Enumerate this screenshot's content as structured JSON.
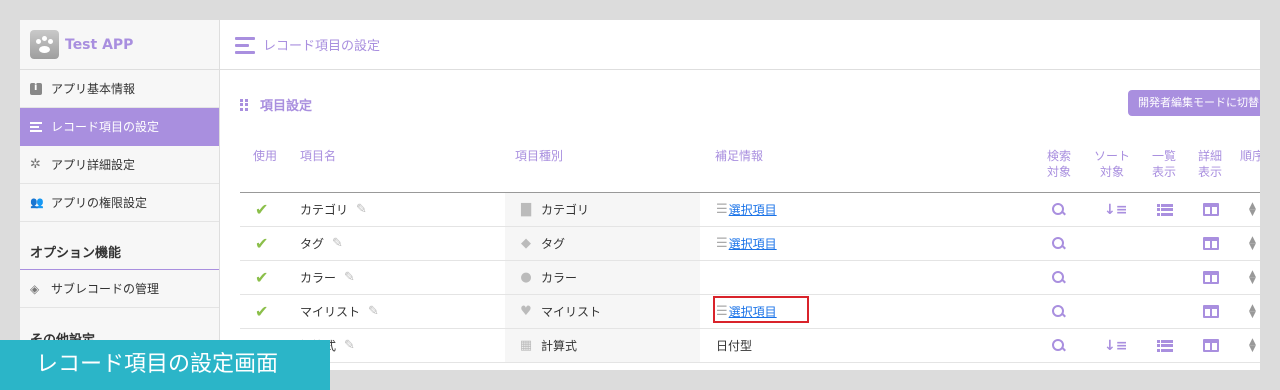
{
  "app": {
    "name": "Test APP"
  },
  "sidebar": {
    "items": [
      {
        "label": "アプリ基本情報",
        "icon": "info-icon",
        "active": false
      },
      {
        "label": "レコード項目の設定",
        "icon": "list-icon",
        "active": true
      },
      {
        "label": "アプリ詳細設定",
        "icon": "gear-icon",
        "active": false
      },
      {
        "label": "アプリの権限設定",
        "icon": "user-lock-icon",
        "active": false
      }
    ],
    "option_heading": "オプション機能",
    "option_items": [
      {
        "label": "サブレコードの管理",
        "icon": "layers-icon"
      }
    ],
    "other_heading": "その他設定"
  },
  "header": {
    "title": "レコード項目の設定"
  },
  "panel": {
    "title": "項目設定",
    "dev_button": "開発者編集モードに切替"
  },
  "table": {
    "columns": {
      "use": "使用",
      "name": "項目名",
      "type": "項目種別",
      "info": "補足情報",
      "search": [
        "検索",
        "対象"
      ],
      "sort": [
        "ソート",
        "対象"
      ],
      "list": [
        "一覧",
        "表示"
      ],
      "detail": [
        "詳細",
        "表示"
      ],
      "order": "順序"
    },
    "rows": [
      {
        "name": "カテゴリ",
        "type": "カテゴリ",
        "type_icon": "folder-icon",
        "info": "選択項目",
        "info_link": true,
        "search": true,
        "sort": true,
        "list": true,
        "detail": true
      },
      {
        "name": "タグ",
        "type": "タグ",
        "type_icon": "tag-icon",
        "info": "選択項目",
        "info_link": true,
        "search": true,
        "sort": false,
        "list": false,
        "detail": true
      },
      {
        "name": "カラー",
        "type": "カラー",
        "type_icon": "palette-icon",
        "info": "",
        "info_link": false,
        "search": true,
        "sort": false,
        "list": false,
        "detail": true
      },
      {
        "name": "マイリスト",
        "type": "マイリスト",
        "type_icon": "heart-icon",
        "info": "選択項目",
        "info_link": true,
        "search": true,
        "sort": false,
        "list": false,
        "detail": true
      },
      {
        "name": "計算式",
        "type": "計算式",
        "type_icon": "calculator-icon",
        "info": "日付型",
        "info_link": false,
        "search": true,
        "sort": true,
        "list": true,
        "detail": true
      }
    ]
  },
  "caption": "レコード項目の設定画面",
  "colors": {
    "accent": "#a98fdf",
    "check": "#8bbf4a",
    "link": "#1a73e8",
    "highlight": "#d9232b",
    "banner": "#2bb5c8"
  }
}
